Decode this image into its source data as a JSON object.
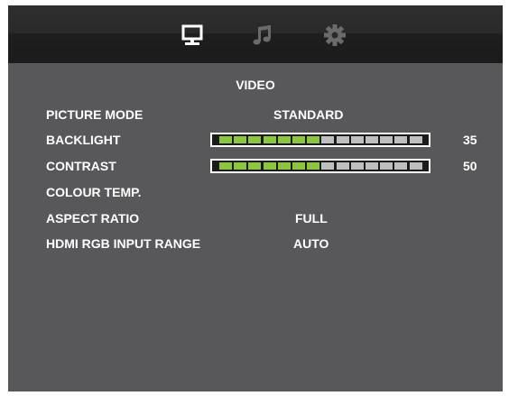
{
  "tabs": [
    {
      "id": "video",
      "icon": "monitor-icon",
      "active": true
    },
    {
      "id": "audio",
      "icon": "music-note-icon",
      "active": false
    },
    {
      "id": "setup",
      "icon": "gear-icon",
      "active": false
    }
  ],
  "menu": {
    "title": "VIDEO",
    "items": [
      {
        "label": "PICTURE MODE",
        "value": "STANDARD"
      },
      {
        "label": "BACKLIGHT",
        "value": "35",
        "level": 35,
        "segments_total": 14,
        "segments_lit": 7
      },
      {
        "label": "CONTRAST",
        "value": "50",
        "level": 50,
        "segments_total": 14,
        "segments_lit": 7
      },
      {
        "label": "COLOUR TEMP.",
        "value": ""
      },
      {
        "label": "ASPECT RATIO",
        "value": "FULL"
      },
      {
        "label": "HDMI RGB INPUT RANGE",
        "value": "AUTO"
      }
    ]
  },
  "colors": {
    "panel": "#58585a",
    "tab_bar": "#1b1b1b",
    "bar_lit": "#8cc63e",
    "bar_unlit": "#bfbfbf",
    "icon_active": "#ffffff",
    "icon_inactive": "#6b6b6b",
    "text": "#ffffff"
  }
}
